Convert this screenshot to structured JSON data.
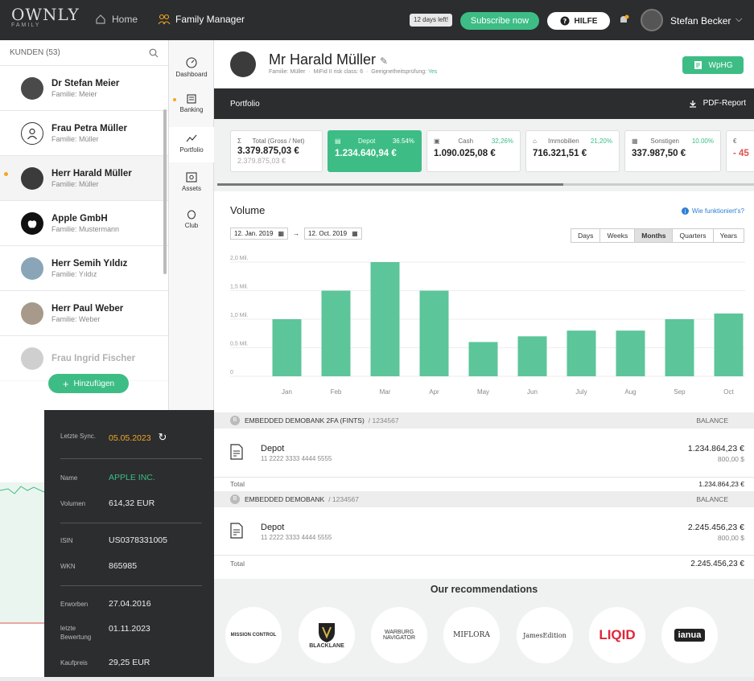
{
  "topbar": {
    "logo_big": "OWNLY",
    "logo_small": "FAMILY",
    "home": "Home",
    "family_manager": "Family Manager",
    "days_left": "12 days left!",
    "subscribe": "Subscribe now",
    "help": "HILFE",
    "user_name": "Stefan Becker"
  },
  "customers": {
    "header": "KUNDEN (53)",
    "items": [
      {
        "name": "Dr Stefan Meier",
        "family": "Familie: Meier"
      },
      {
        "name": "Frau Petra Müller",
        "family": "Familie: Müller"
      },
      {
        "name": "Herr Harald Müller",
        "family": "Familie: Müller"
      },
      {
        "name": "Apple GmbH",
        "family": "Familie: Mustermann"
      },
      {
        "name": "Herr Semih Yıldız",
        "family": "Familie: Yıldız"
      },
      {
        "name": "Herr Paul Weber",
        "family": "Familie: Weber"
      },
      {
        "name": "Frau Ingrid Fischer",
        "family": ""
      }
    ],
    "add_button": "Hinzufügen"
  },
  "sidenav": {
    "dashboard": "Dashboard",
    "banking": "Banking",
    "portfolio": "Portfolio",
    "assets": "Assets",
    "club": "Club"
  },
  "client": {
    "name": "Mr Harald Müller",
    "family": "Familie: Müller",
    "risk": "MiFid II risk class: 6",
    "suitability_label": "Geeignetheitsprüfung:",
    "suitability_value": "Yes",
    "wphg": "WpHG"
  },
  "portfolio_bar": {
    "label": "Portfolio",
    "pdf": "PDF-Report"
  },
  "kpis": {
    "total_label": "Total (Gross / Net)",
    "total_gross": "3.379.875,03 €",
    "total_net": "2.379.875,03 €",
    "depot_label": "Depot",
    "depot_pct": "36.54%",
    "depot_val": "1.234.640,94 €",
    "cash_label": "Cash",
    "cash_pct": "32,26%",
    "cash_val": "1.090.025,08 €",
    "immo_label": "Immobilien",
    "immo_pct": "21,20%",
    "immo_val": "716.321,51 €",
    "sonst_label": "Sonstigen",
    "sonst_pct": "10.00%",
    "sonst_val": "337.987,50 €",
    "cut_val": "- 45"
  },
  "volume": {
    "title": "Volume",
    "how": "Wie funktioniert's?",
    "date_from": "12. Jan. 2019",
    "date_to": "12. Oct. 2019",
    "periods": [
      "Days",
      "Weeks",
      "Months",
      "Quarters",
      "Years"
    ],
    "active_period": "Months"
  },
  "chart_data": {
    "type": "bar",
    "categories": [
      "Jan",
      "Feb",
      "Mar",
      "Apr",
      "May",
      "Jun",
      "July",
      "Aug",
      "Sep",
      "Oct"
    ],
    "values": [
      1.0,
      1.5,
      2.0,
      1.5,
      0.6,
      0.7,
      0.8,
      0.8,
      1.0,
      1.1
    ],
    "yticks": [
      "0",
      "0,5 Mil.",
      "1,0 Mil.",
      "1,5 Mil.",
      "2,0 Mil."
    ],
    "ylim": [
      0,
      2.0
    ],
    "color": "#5cc59a"
  },
  "detail": {
    "sync_label": "Letzte Sync.",
    "sync_date": "05.05.2023",
    "name_label": "Name",
    "name_value": "APPLE INC.",
    "volume_label": "Volumen",
    "volume_value": "614,32 EUR",
    "isin_label": "ISIN",
    "isin_value": "US0378331005",
    "wkn_label": "WKN",
    "wkn_value": "865985",
    "bought_label": "Erworben",
    "bought_value": "27.04.2016",
    "last_eval_label": "letzte Bewertung",
    "last_eval_value": "01.11.2023",
    "price_label": "Kaufpreis",
    "price_value": "29,25 EUR"
  },
  "banks": [
    {
      "name": "EMBEDDED DEMOBANK 2FA (FINTS)",
      "id": "/ 1234567",
      "balance_label": "BALANCE",
      "account_name": "Depot",
      "account_number": "11 2222 3333 4444 5555",
      "amount_eur": "1.234.864,23 €",
      "amount_usd": "800,00 $",
      "total_label": "Total",
      "total": "1.234.864,23 €"
    },
    {
      "name": "EMBEDDED DEMOBANK",
      "id": "/ 1234567",
      "balance_label": "BALANCE",
      "account_name": "Depot",
      "account_number": "11 2222 3333 4444 5555",
      "amount_eur": "2.245.456,23 €",
      "amount_usd": "800,00 $",
      "total_label": "Total",
      "total": "2.245.456,23 €"
    }
  ],
  "recommendations": {
    "title": "Our recommendations",
    "logos": [
      "MISSION CONTROL",
      "BLACKLANE",
      "WARBURG NAVIGATOR",
      "MIFLORA",
      "JamesEdition",
      "LIQID",
      "ianua"
    ]
  }
}
